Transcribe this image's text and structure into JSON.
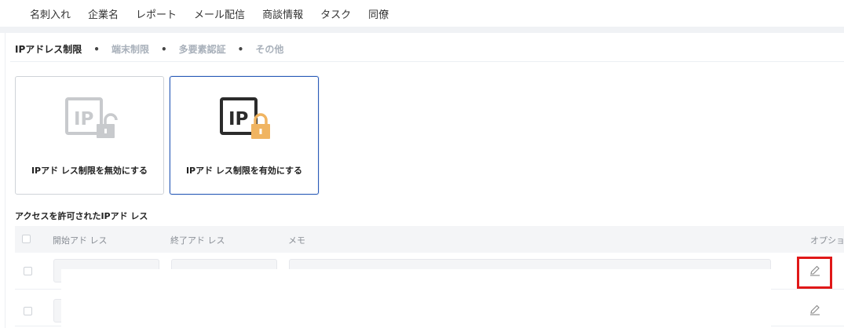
{
  "topnav": {
    "items": [
      "名刺入れ",
      "企業名",
      "レポート",
      "メール配信",
      "商談情報",
      "タスク",
      "同僚"
    ]
  },
  "subtabs": {
    "items": [
      {
        "label": "IPアドレス制限",
        "active": true
      },
      {
        "label": "端末制限",
        "active": false
      },
      {
        "label": "多要素認証",
        "active": false
      },
      {
        "label": "その他",
        "active": false
      }
    ],
    "separator": "•"
  },
  "cards": {
    "disable": {
      "label": "IPアド レス制限を無効にする",
      "icon": "ip-unlock-icon",
      "selected": false
    },
    "enable": {
      "label": "IPアド レス制限を有効にする",
      "icon": "ip-lock-icon",
      "selected": true
    }
  },
  "section": {
    "title": "アクセスを許可されたIPアド レス"
  },
  "table": {
    "headers": {
      "start": "開始アド レス",
      "end": "終了アド レス",
      "memo": "メモ",
      "options": "オプション"
    },
    "rows": [
      {
        "start": "",
        "end": "",
        "memo": ""
      },
      {
        "start": "",
        "end": "",
        "memo": ""
      }
    ]
  },
  "colors": {
    "accent": "#2a5bb8",
    "lock_orange": "#f0b461",
    "highlight": "#e01818"
  }
}
